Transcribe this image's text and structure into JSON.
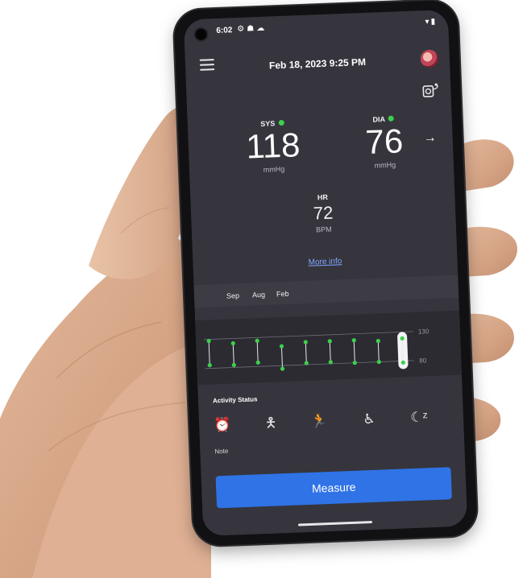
{
  "status_bar": {
    "time": "6:02",
    "notification_icons": [
      "gear-icon",
      "android-icon",
      "cloud-icon"
    ],
    "system_icons": [
      "wifi-icon",
      "battery-icon"
    ]
  },
  "header": {
    "datetime": "Feb 18, 2023 9:25 PM",
    "menu_icon": "hamburger-menu-icon",
    "avatar": "user-avatar",
    "device_icon": "blood-pressure-monitor-icon"
  },
  "readings": {
    "systolic": {
      "label": "SYS",
      "value": "118",
      "unit": "mmHg",
      "status_color": "#3bd14c"
    },
    "diastolic": {
      "label": "DIA",
      "value": "76",
      "unit": "mmHg",
      "status_color": "#3bd14c"
    },
    "next_icon": "arrow-right-icon"
  },
  "heart_rate": {
    "label": "HR",
    "value": "72",
    "unit": "BPM"
  },
  "more_info_link": "More info",
  "history": {
    "months": [
      "Sep",
      "Aug",
      "Feb"
    ],
    "axis_labels": [
      "130",
      "80"
    ],
    "point_color": "#3bd14c",
    "readings_count": 9,
    "selected_index": 8
  },
  "activity": {
    "title": "Activity Status",
    "icons": [
      "alarm-clock-icon",
      "standing-person-icon",
      "running-person-icon",
      "sitting-person-icon",
      "sleeping-moon-icon"
    ],
    "note_label": "Note"
  },
  "measure_button": "Measure",
  "colors": {
    "accent": "#2f73e6",
    "background": "#36353d",
    "link": "#7fa6ff"
  }
}
